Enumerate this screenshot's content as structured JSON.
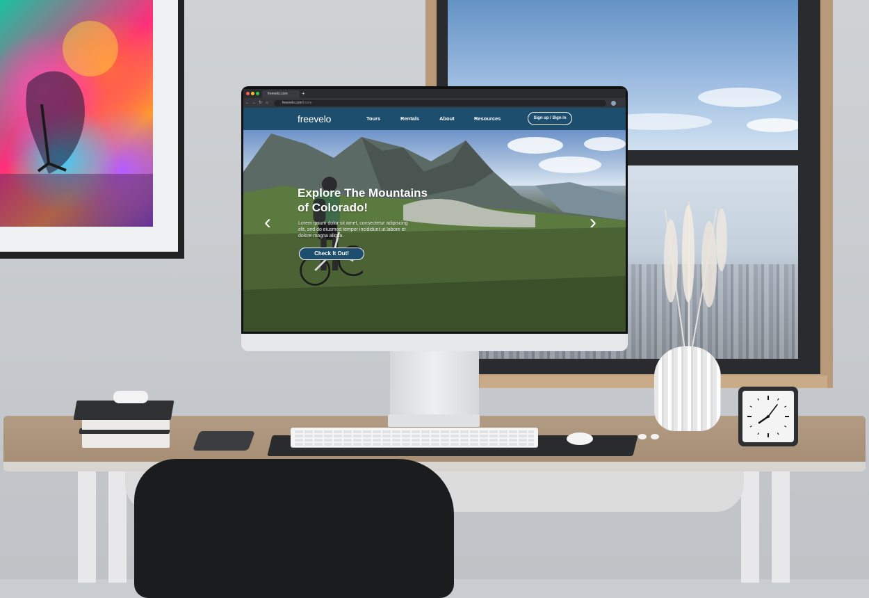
{
  "browser": {
    "tab_title": "freevelo.com",
    "new_tab_glyph": "+",
    "nav_icons": [
      "back-icon",
      "forward-icon",
      "reload-icon",
      "home-icon",
      "lock-icon"
    ],
    "url_domain": "freevelo.com",
    "url_path": "/home"
  },
  "site": {
    "logo": "freevelo",
    "nav": {
      "tours": "Tours",
      "rentals": "Rentals",
      "about": "About",
      "resources": "Resources"
    },
    "signup_label": "Sign up / Sign in",
    "hero": {
      "title_line1": "Explore The Mountains",
      "title_line2": "of Colorado!",
      "body": "Lorem ipsum dolor sit amet, consectetur adipiscing elit, sed do eiusmod tempor incididunt ut labore et dolore magna aliqua.",
      "cta_label": "Check It Out!",
      "prev_glyph": "‹",
      "next_glyph": "›"
    }
  },
  "colors": {
    "brand_navy": "#1e4e6e",
    "white": "#ffffff",
    "browser_chrome": "#2a2b2f"
  },
  "clock": {
    "hour_markers": 12
  }
}
